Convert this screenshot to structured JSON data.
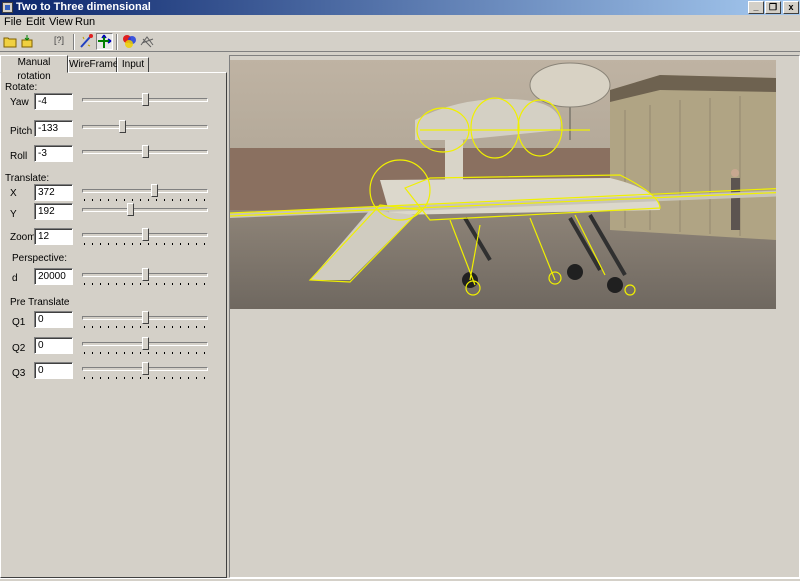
{
  "window": {
    "title": "Two to Three dimensional",
    "controls": {
      "minimize": "_",
      "restore": "❐",
      "close": "x"
    }
  },
  "menu": [
    "File",
    "Edit",
    "View",
    "Run"
  ],
  "toolbar": {
    "bracket_label": "[?]",
    "buttons": [
      "open-folder-icon",
      "load-icon",
      "blank-icon",
      "bracket-icon",
      "magic-wand-icon",
      "axes-move-icon",
      "color-wheel-icon",
      "wireframe-icon"
    ]
  },
  "tabs": [
    {
      "label": "Manual rotation",
      "active": true
    },
    {
      "label": "WireFrame",
      "active": false
    },
    {
      "label": "Input",
      "active": false
    }
  ],
  "sections": {
    "rotate": "Rotate:",
    "translate": "Translate:",
    "perspective": "Perspective:",
    "pre_translate": "Pre Translate"
  },
  "controls": {
    "yaw": {
      "label": "Yaw",
      "value": "-4",
      "slider": 0.5
    },
    "pitch": {
      "label": "Pitch",
      "value": "-133",
      "slider": 0.32
    },
    "roll": {
      "label": "Roll",
      "value": "-3",
      "slider": 0.5
    },
    "x": {
      "label": "X",
      "value": "372",
      "slider": 0.58
    },
    "y": {
      "label": "Y",
      "value": "192",
      "slider": 0.38
    },
    "zoom": {
      "label": "Zoom",
      "value": "12",
      "slider": 0.5
    },
    "d": {
      "label": "d",
      "value": "20000",
      "slider": 0.5
    },
    "q1": {
      "label": "Q1",
      "value": "0",
      "slider": 0.5
    },
    "q2": {
      "label": "Q2",
      "value": "0",
      "slider": 0.5
    },
    "q3": {
      "label": "Q3",
      "value": "0",
      "slider": 0.5
    }
  },
  "viewport": {
    "content": "photo of unmanned aircraft with yellow 3D wireframe overlay",
    "wire_color": "#f0f000"
  }
}
